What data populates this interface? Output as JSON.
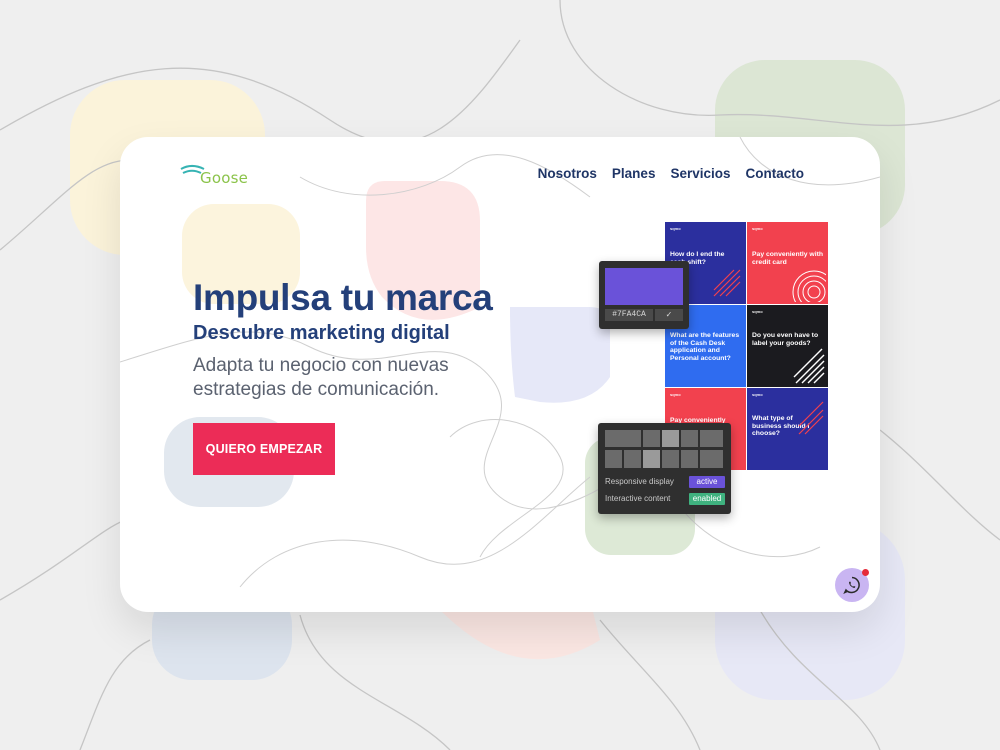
{
  "colors": {
    "page_bg": "#efefef",
    "title": "#24407a",
    "nav": "#1f3566",
    "cta_bg": "#ec2c57",
    "logo_green": "#8bc34a",
    "logo_teal": "#36b3b3",
    "swatch": "#6a52d9",
    "pill_active": "#6a52d9",
    "pill_enabled": "#3fb27f",
    "whatsapp_bg": "#c9b5f2"
  },
  "logo": {
    "text": "Goose"
  },
  "nav": {
    "items": [
      {
        "label": "Nosotros"
      },
      {
        "label": "Planes"
      },
      {
        "label": "Servicios"
      },
      {
        "label": "Contacto"
      }
    ]
  },
  "hero": {
    "title": "Impulsa tu marca",
    "subtitle": "Descubre marketing digital",
    "description": "Adapta tu negocio con nuevas estrategias de comunicación.",
    "cta_label": "QUIERO EMPEZAR"
  },
  "mockup": {
    "tiles": [
      {
        "brand": "sqmo",
        "title": "How do I end the cash shift?",
        "color": "#2b2f9e"
      },
      {
        "brand": "sqmo",
        "title": "Pay conveniently with credit card",
        "color": "#f2414e"
      },
      {
        "brand": "sqmo",
        "title": "What are the features of the Cash Desk application and Personal account?",
        "color": "#2f6cf0"
      },
      {
        "brand": "sqmo",
        "title": "Do you even have to label your goods?",
        "color": "#1b1b1f"
      },
      {
        "brand": "sqmo",
        "title": "Pay conveniently",
        "color": "#f2414e"
      },
      {
        "brand": "sqmo",
        "title": "What type of business should I choose?",
        "color": "#2b2f9e"
      }
    ],
    "color_picker": {
      "hex": "#7FA4CA",
      "eyedropper_icon": "eyedropper-icon"
    },
    "layout_panel": {
      "rows": [
        {
          "label": "Responsive display",
          "badge": "active"
        },
        {
          "label": "Interactive content",
          "badge": "enabled"
        }
      ]
    }
  },
  "whatsapp": {
    "icon": "whatsapp-icon"
  }
}
